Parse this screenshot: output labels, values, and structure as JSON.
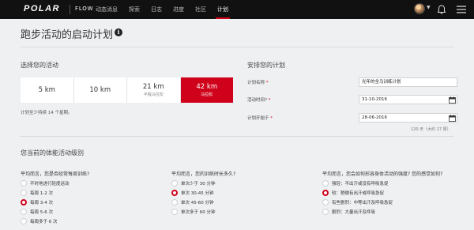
{
  "topbar": {
    "logo": "POLAR",
    "flow_label": "FLOW",
    "nav": [
      "动态消息",
      "探索",
      "日志",
      "进度",
      "社区",
      "计划"
    ],
    "active_nav": "计划"
  },
  "page": {
    "title": "跑步活动的启动计划",
    "info_glyph": "i"
  },
  "activity": {
    "title": "选择您的活动",
    "tiles": [
      {
        "main": "5 km",
        "sub": ""
      },
      {
        "main": "10 km",
        "sub": ""
      },
      {
        "main": "21 km",
        "sub": "半程马拉松"
      },
      {
        "main": "42 km",
        "sub": "马拉松"
      }
    ],
    "selected": "42 km",
    "note": "计划至少持续 14 个星期。"
  },
  "schedule": {
    "title": "安排您的计划",
    "name_label": "计划名称",
    "name_value": "光年的全马训练计划",
    "event_label": "活动时间?",
    "event_value": "31-10-2016",
    "start_label": "计划开始于",
    "start_value": "28-06-2016",
    "required_mark": "*",
    "duration": "120 天（大约 17 周）"
  },
  "level": {
    "title": "您当前的体能活动级别",
    "questions": [
      {
        "title": "平均而言，您是否经常每周训练?",
        "options": [
          "不时地进行轻度运动",
          "每周 1-2 次",
          "每周 3-4 次",
          "每周 5-6 次",
          "每周多于 6 次"
        ],
        "selected": 2
      },
      {
        "title": "平均而言，您的训练时长多久?",
        "options": [
          "单次少于 30 分钟",
          "单次 30-45 分钟",
          "单次 45-60 分钟",
          "单次多于 60 分钟"
        ],
        "selected": 1
      },
      {
        "title": "平均而言，您会如何形容身体活动的强度? 您的感觉如何?",
        "options": [
          "强轻：不出汗或没有呼吸急促",
          "较：稍微有出汗或呼吸急促",
          "有些剧烈：中等出汗及呼吸急促",
          "剧烈：大量出汗及呼吸"
        ],
        "selected": 1
      }
    ]
  },
  "colors": {
    "accent": "#d0021b",
    "topbar": "#111111",
    "background": "#eef0f1"
  },
  "icons": [
    "info-icon",
    "avatar",
    "chevron-down-icon",
    "bell-icon",
    "menu-icon",
    "calendar-icon"
  ]
}
